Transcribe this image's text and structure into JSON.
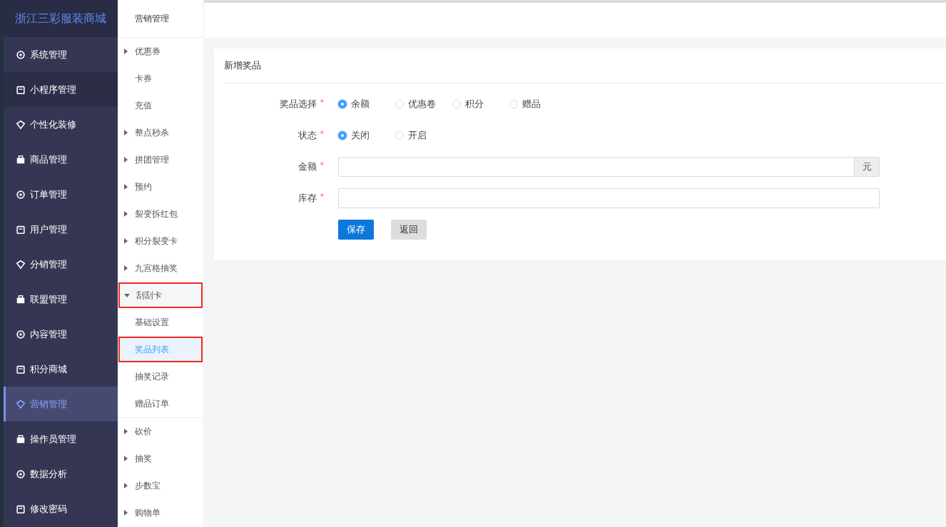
{
  "brand": "浙江三彩服装商城",
  "menu": [
    {
      "label": "系统管理",
      "selected": false,
      "hover": true
    },
    {
      "label": "小程序管理",
      "selected": false,
      "hover": false
    },
    {
      "label": "个性化装修",
      "selected": false,
      "hover": true
    },
    {
      "label": "商品管理",
      "selected": false,
      "hover": true
    },
    {
      "label": "订单管理",
      "selected": false,
      "hover": true
    },
    {
      "label": "用户管理",
      "selected": false,
      "hover": true
    },
    {
      "label": "分销管理",
      "selected": false,
      "hover": true
    },
    {
      "label": "联盟管理",
      "selected": false,
      "hover": true
    },
    {
      "label": "内容管理",
      "selected": false,
      "hover": true
    },
    {
      "label": "积分商城",
      "selected": false,
      "hover": true
    },
    {
      "label": "营销管理",
      "selected": true,
      "hover": true
    },
    {
      "label": "操作员管理",
      "selected": false,
      "hover": true
    },
    {
      "label": "数据分析",
      "selected": false,
      "hover": true
    },
    {
      "label": "修改密码",
      "selected": false,
      "hover": true
    }
  ],
  "submenu": {
    "title": "营销管理",
    "items": [
      {
        "kind": "group",
        "label": "优惠券",
        "expanded": false,
        "highlighted": false
      },
      {
        "kind": "leaf",
        "label": "卡券",
        "selected": false,
        "highlighted": false
      },
      {
        "kind": "leaf",
        "label": "充值",
        "selected": false,
        "highlighted": false
      },
      {
        "kind": "group",
        "label": "整点秒杀",
        "expanded": false,
        "highlighted": false
      },
      {
        "kind": "group",
        "label": "拼团管理",
        "expanded": false,
        "highlighted": false
      },
      {
        "kind": "group",
        "label": "预约",
        "expanded": false,
        "highlighted": false
      },
      {
        "kind": "group",
        "label": "裂变拆红包",
        "expanded": false,
        "highlighted": false
      },
      {
        "kind": "group",
        "label": "积分裂变卡",
        "expanded": false,
        "highlighted": false
      },
      {
        "kind": "group",
        "label": "九宫格抽奖",
        "expanded": false,
        "highlighted": false
      },
      {
        "kind": "group",
        "label": "刮刮卡",
        "expanded": true,
        "highlighted": true,
        "children": [
          {
            "label": "基础设置",
            "selected": false,
            "highlighted": false
          },
          {
            "label": "奖品列表",
            "selected": true,
            "highlighted": true
          },
          {
            "label": "抽奖记录",
            "selected": false,
            "highlighted": false
          },
          {
            "label": "赠品订单",
            "selected": false,
            "highlighted": false
          }
        ]
      },
      {
        "kind": "group",
        "label": "砍价",
        "expanded": false,
        "highlighted": false
      },
      {
        "kind": "group",
        "label": "抽奖",
        "expanded": false,
        "highlighted": false
      },
      {
        "kind": "group",
        "label": "步数宝",
        "expanded": false,
        "highlighted": false
      },
      {
        "kind": "group",
        "label": "购物单",
        "expanded": false,
        "highlighted": false
      }
    ]
  },
  "form": {
    "title": "新增奖品",
    "fields": [
      {
        "kind": "radio",
        "label": "奖品选择",
        "required_mark": "*",
        "options": [
          {
            "label": "余额",
            "selected": true
          },
          {
            "label": "优惠卷",
            "selected": false
          },
          {
            "label": "积分",
            "selected": false
          },
          {
            "label": "赠品",
            "selected": false
          }
        ]
      },
      {
        "kind": "radio",
        "label": "状态",
        "required_mark": "*",
        "options": [
          {
            "label": "关闭",
            "selected": true
          },
          {
            "label": "开启",
            "selected": false
          }
        ]
      },
      {
        "kind": "input",
        "label": "金额",
        "required_mark": "*",
        "suffix": "元"
      },
      {
        "kind": "input",
        "label": "库存",
        "required_mark": "*"
      }
    ],
    "buttons": [
      {
        "label": "保存",
        "kind": "primary"
      },
      {
        "label": "返回",
        "kind": "default"
      }
    ]
  }
}
